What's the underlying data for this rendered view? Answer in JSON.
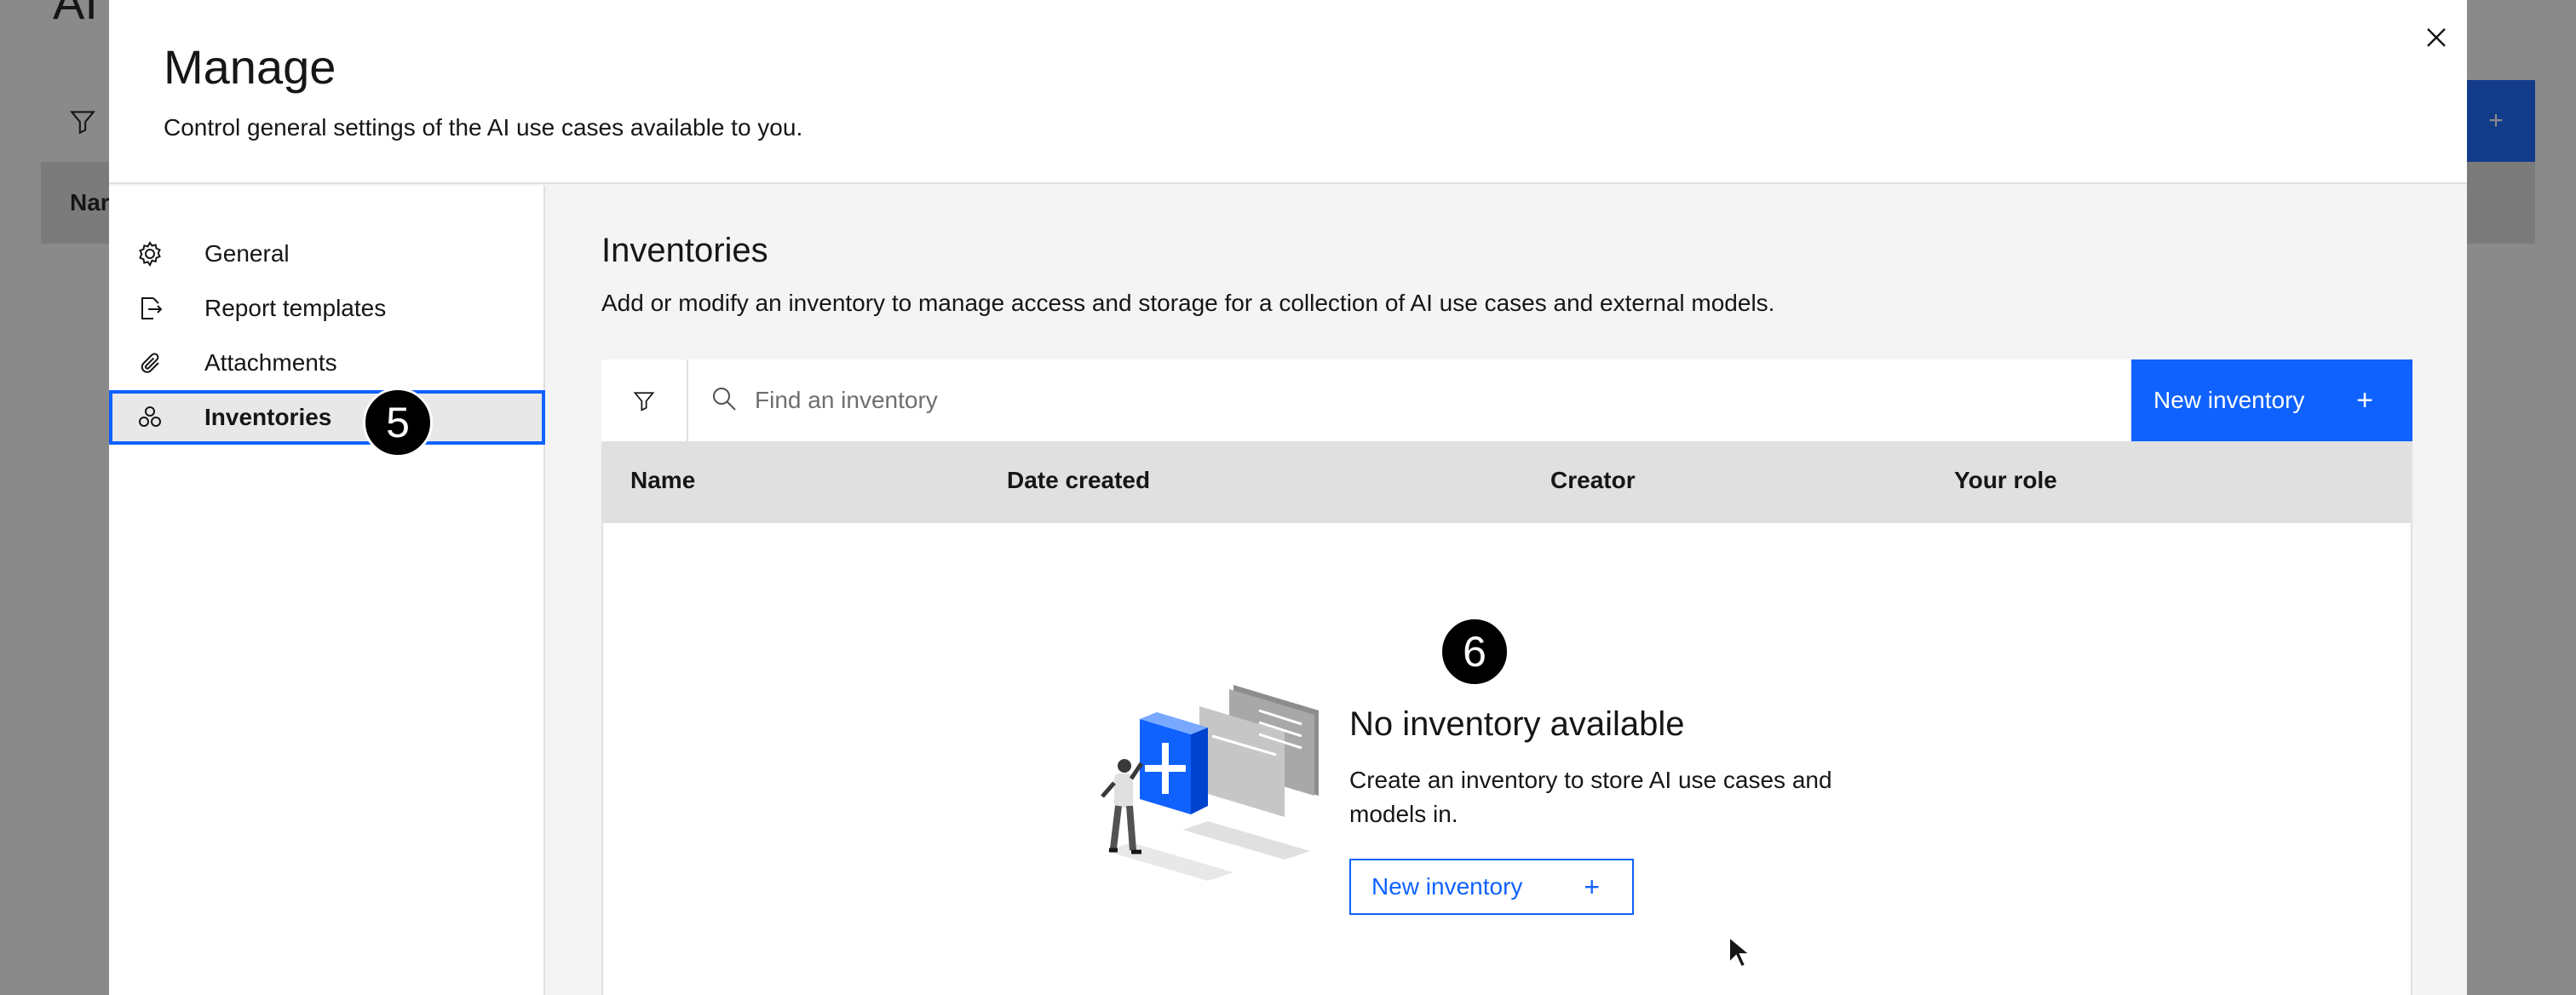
{
  "background": {
    "title": "AI",
    "header_col": "Nar",
    "add_symbol": "+"
  },
  "modal": {
    "title": "Manage",
    "subtitle": "Control general settings of the AI use cases available to you.",
    "close_icon": "close-icon"
  },
  "nav": {
    "items": [
      {
        "label": "General",
        "icon": "gear-icon",
        "active": false
      },
      {
        "label": "Report templates",
        "icon": "document-export-icon",
        "active": false
      },
      {
        "label": "Attachments",
        "icon": "paperclip-icon",
        "active": false
      },
      {
        "label": "Inventories",
        "icon": "inventory-icon",
        "active": true
      }
    ]
  },
  "content": {
    "title": "Inventories",
    "description": "Add or modify an inventory to manage access and storage for a collection of AI use cases and external models.",
    "search": {
      "placeholder": "Find an inventory",
      "value": ""
    },
    "new_button": {
      "label": "New inventory",
      "symbol": "+"
    },
    "columns": [
      "Name",
      "Date created",
      "Creator",
      "Your role"
    ],
    "empty_state": {
      "title": "No inventory available",
      "description": "Create an inventory to store AI use cases and models in.",
      "button_label": "New inventory",
      "button_symbol": "+"
    }
  },
  "annotations": {
    "step_5": "5",
    "step_6": "6"
  },
  "colors": {
    "primary": "#0f62fe",
    "header_gray": "#e0e0e0",
    "panel_gray": "#f4f4f4"
  }
}
